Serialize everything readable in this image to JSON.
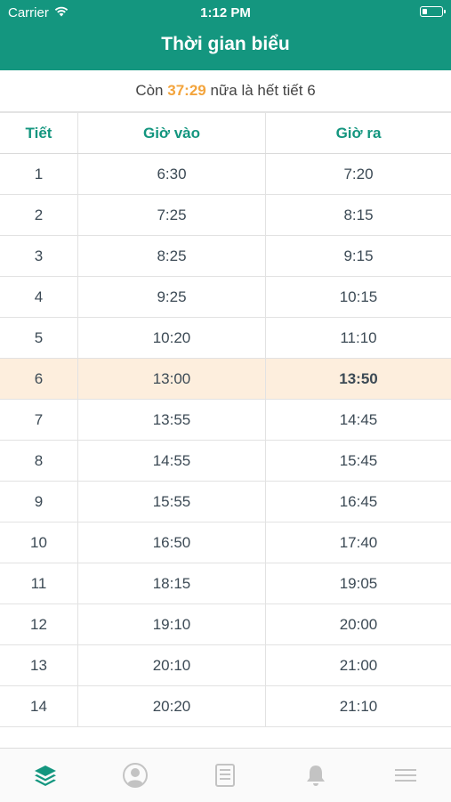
{
  "status_bar": {
    "carrier": "Carrier",
    "time": "1:12 PM"
  },
  "header": {
    "title": "Thời gian biểu"
  },
  "countdown": {
    "prefix": "Còn",
    "time": "37:29",
    "suffix": "nữa là hết tiết 6"
  },
  "table": {
    "columns": [
      "Tiết",
      "Giờ vào",
      "Giờ ra"
    ],
    "active_row": 6,
    "rows": [
      {
        "period": "1",
        "in": "6:30",
        "out": "7:20"
      },
      {
        "period": "2",
        "in": "7:25",
        "out": "8:15"
      },
      {
        "period": "3",
        "in": "8:25",
        "out": "9:15"
      },
      {
        "period": "4",
        "in": "9:25",
        "out": "10:15"
      },
      {
        "period": "5",
        "in": "10:20",
        "out": "11:10"
      },
      {
        "period": "6",
        "in": "13:00",
        "out": "13:50"
      },
      {
        "period": "7",
        "in": "13:55",
        "out": "14:45"
      },
      {
        "period": "8",
        "in": "14:55",
        "out": "15:45"
      },
      {
        "period": "9",
        "in": "15:55",
        "out": "16:45"
      },
      {
        "period": "10",
        "in": "16:50",
        "out": "17:40"
      },
      {
        "period": "11",
        "in": "18:15",
        "out": "19:05"
      },
      {
        "period": "12",
        "in": "19:10",
        "out": "20:00"
      },
      {
        "period": "13",
        "in": "20:10",
        "out": "21:00"
      },
      {
        "period": "14",
        "in": "20:20",
        "out": "21:10"
      }
    ]
  },
  "tabbar": {
    "items": [
      {
        "icon": "layers-icon",
        "active": true
      },
      {
        "icon": "user-icon",
        "active": false
      },
      {
        "icon": "notes-icon",
        "active": false
      },
      {
        "icon": "bell-icon",
        "active": false
      },
      {
        "icon": "menu-icon",
        "active": false
      }
    ]
  },
  "colors": {
    "primary": "#14967f",
    "highlight_bg": "#fdeedd",
    "countdown_time": "#f3a43c",
    "inactive_icon": "#c3c3c3"
  }
}
